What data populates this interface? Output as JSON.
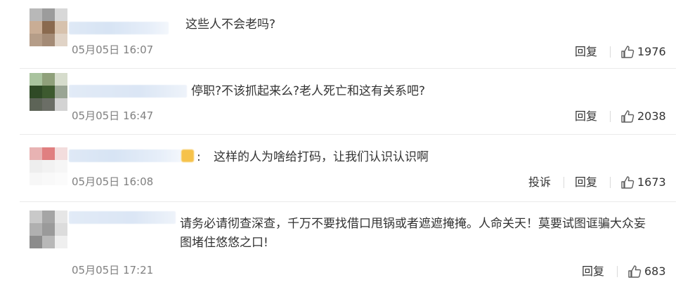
{
  "comments": [
    {
      "text": "这些人不会老吗?",
      "time": "05月05日 16:07",
      "reply_label": "回复",
      "likes": "1976",
      "avatar_colors": [
        "#b8b8b8",
        "#9c9c9c",
        "#d8d8d8",
        "#c9ad95",
        "#8a6a4f",
        "#d7c2ad",
        "#b59d88",
        "#a48b76",
        "#e0d3c6"
      ]
    },
    {
      "text": "停职?不该抓起来么?老人死亡和这有关系吧?",
      "time": "05月05日 16:47",
      "reply_label": "回复",
      "likes": "2038",
      "avatar_colors": [
        "#a9c39e",
        "#8fa07a",
        "#d6dccc",
        "#2f4a26",
        "#3d5a2f",
        "#9aa594",
        "#5d6457",
        "#6b6e66",
        "#d3d3d3"
      ]
    },
    {
      "text": "这样的人为啥给打码，让我们认识认识啊",
      "prefix": ":",
      "time": "05月05日 16:08",
      "report_label": "投诉",
      "reply_label": "回复",
      "likes": "1673",
      "avatar_colors": [
        "#e8b3b3",
        "#e07f80",
        "#f3dddd",
        "#eeeeee",
        "#f2f2f2",
        "#f6f6f6",
        "#f7f7f7",
        "#f9f9f9",
        "#fbfbfb"
      ]
    },
    {
      "text": "请务必请彻查深查，千万不要找借口甩锅或者遮遮掩掩。人命关天！莫要试图诓骗大众妄\n图堵住悠悠之口!",
      "time": "05月05日 17:21",
      "reply_label": "回复",
      "likes": "683",
      "avatar_colors": [
        "#c9c9c9",
        "#a5a5a5",
        "#e6e6e6",
        "#b0b0b0",
        "#9a9a9a",
        "#dcdcdc",
        "#8c8c8c",
        "#b8b8b8",
        "#efefef"
      ]
    }
  ],
  "icons": {
    "like": "thumbs-up-icon"
  },
  "colors": {
    "text": "#333333",
    "time": "#808080",
    "divider": "#eaeaea"
  }
}
